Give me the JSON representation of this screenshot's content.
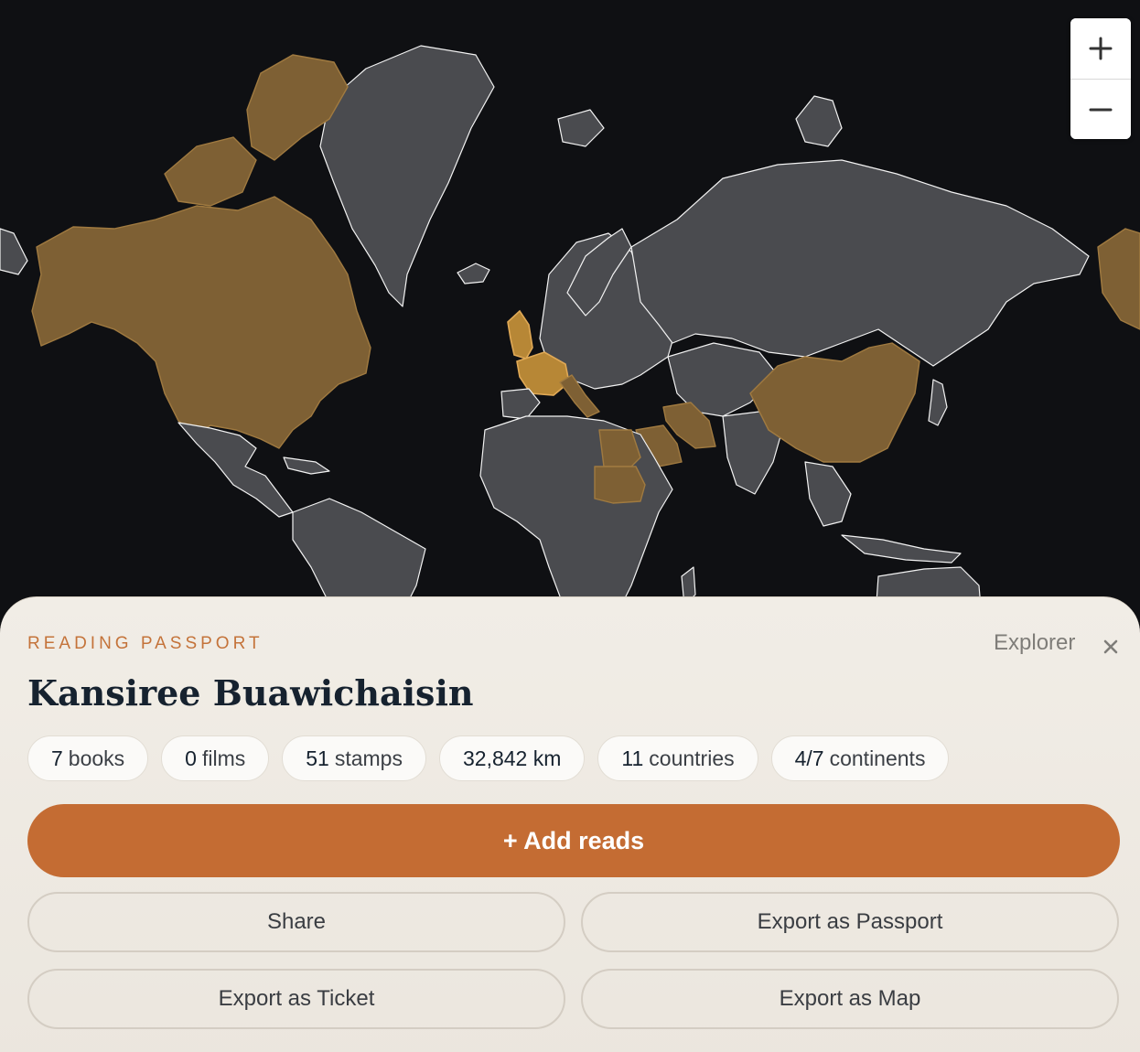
{
  "map": {
    "highlight_color": "#7e6034",
    "land_color": "#4a4b4f",
    "ocean_color": "#0f1013",
    "visited_regions": [
      "Canada",
      "United States",
      "Alaska",
      "United Kingdom",
      "France",
      "Italy",
      "Egypt",
      "Sudan",
      "Saudi Arabia",
      "Iran",
      "China"
    ]
  },
  "zoom": {
    "zoom_in_icon": "plus-icon",
    "zoom_out_icon": "minus-icon"
  },
  "panel": {
    "eyebrow": "READING PASSPORT",
    "mode_label": "Explorer",
    "close_icon": "close-icon",
    "user_name": "Kansiree Buawichaisin",
    "stats": [
      {
        "num": "7",
        "label": "books"
      },
      {
        "num": "0",
        "label": "films"
      },
      {
        "num": "51",
        "label": "stamps"
      },
      {
        "num": "32,842 km",
        "label": ""
      },
      {
        "num": "11",
        "label": "countries"
      },
      {
        "num": "4/7",
        "label": "continents"
      }
    ],
    "add_button": "+ Add reads",
    "share_button": "Share",
    "export_passport_button": "Export as Passport",
    "export_ticket_button": "Export as Ticket",
    "export_map_button": "Export as Map",
    "accent_color": "#c46c33"
  }
}
